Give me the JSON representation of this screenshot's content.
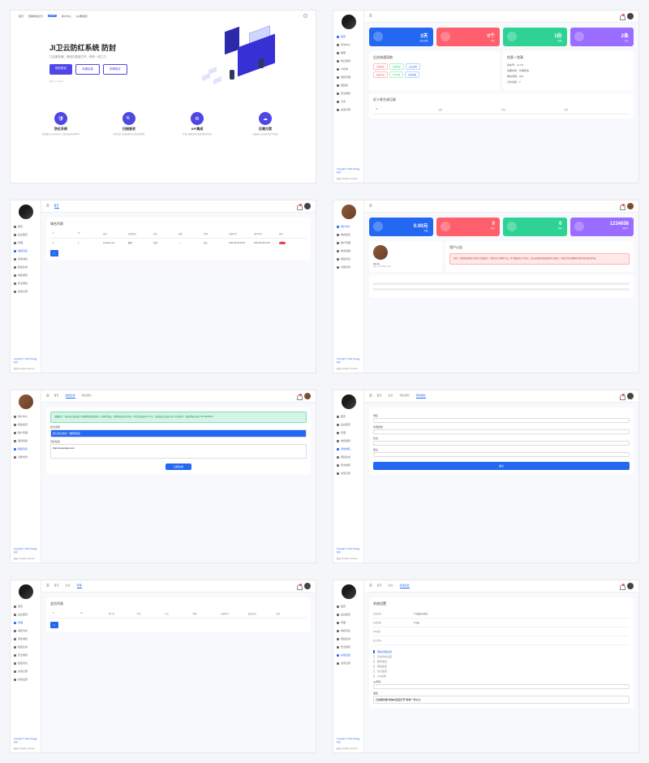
{
  "landing": {
    "nav": [
      "首页",
      "查看我的红分",
      "用户中心",
      "QQ群答题"
    ],
    "nav_badge": "v2.0.8",
    "title": "JI卫云防红系统 防封",
    "subtitle": "已启服务器，微信内直接打开，助你一臂之力",
    "btn_primary": "现在购买",
    "btn_outline1": "详细信息",
    "btn_outline2": "来聊防红",
    "features": [
      {
        "icon": "🛡",
        "title": "防红系统",
        "desc": "长期研发 全自动对抗 专业红队成功率99%"
      },
      {
        "icon": "🔍",
        "title": "扫描查收",
        "desc": "实时监控 多维度检测 自动识别风险"
      },
      {
        "icon": "⚙",
        "title": "API集成",
        "desc": "全接口参数说明 集成到您的系统"
      },
      {
        "icon": "☁",
        "title": "后端方案",
        "desc": "海量云节点加速 稳定不掉线"
      }
    ]
  },
  "dash1": {
    "sidebar": [
      "首页",
      "安全中心",
      "数据",
      "防红规则",
      "IP名单",
      "域名管理",
      "短链接",
      "安全规则",
      "日志",
      "充值记录"
    ],
    "stats": [
      {
        "v": "3天",
        "l": "剩余天数",
        "c": "#2468f2"
      },
      {
        "v": "0个",
        "l": "域名",
        "c": "#ff5e6c"
      },
      {
        "v": "1份",
        "l": "套餐",
        "c": "#2ed295"
      },
      {
        "v": "2条",
        "l": "日志",
        "c": "#9a6cff"
      }
    ],
    "panel_l_title": "后台快速导航",
    "quick": [
      [
        "添加域名",
        "查看列表",
        "安全设置"
      ],
      [
        "短链生成",
        "API文档",
        "充值续费"
      ]
    ],
    "panel_r_title": "信息一览表",
    "info": [
      "版本号：v2.0.8",
      "到期时间：长期有效",
      "剩余调用：999",
      "日志条数：2"
    ],
    "log_title": "近十条生成记录",
    "log_head": [
      "ID",
      "域名",
      "时间",
      "状态"
    ]
  },
  "dash2": {
    "sidebar": [
      "首页",
      "后台首页",
      "管理",
      "域名列表",
      "添加域名",
      "短链生成",
      "域名规则",
      "安全规则",
      "充值记录"
    ],
    "tabs": [
      "首页"
    ],
    "panel_title": "域名列表",
    "thead": [
      "#",
      "ID",
      "域名",
      "处理类型",
      "状态",
      "刷新",
      "到期",
      "创建时间",
      "操作时间",
      "操作"
    ],
    "row": [
      "1",
      "1",
      "example.com",
      "跳转",
      "正常",
      "—",
      "永久",
      "2022-09-09 00:00",
      "2022-09-09 00:00"
    ],
    "row_action": "删除",
    "page": "1"
  },
  "dash3": {
    "sidebar": [
      "用户中心",
      "我的会员",
      "账户管理",
      "邀请奖励",
      "短链列表",
      "对账支持"
    ],
    "stats": [
      {
        "v": "0.00元",
        "l": "余额",
        "c": "#2468f2"
      },
      {
        "v": "0",
        "l": "积分",
        "c": "#ff5e6c"
      },
      {
        "v": "0",
        "l": "优惠",
        "c": "#2ed295"
      },
      {
        "v": "1234658",
        "l": "推荐人",
        "c": "#9a6cff"
      }
    ],
    "prof_name": "admin",
    "prof_uid": "UID: 20220913-000",
    "panel_r_title": "用户公告",
    "alert": "您好，欢迎您使用防红系统产品及服务！请您务必了解本产品，并仔细阅读以下协议；您点击同意并开始使用产品服务，即表示您已理解并同意本协议各项内容。"
  },
  "dash4": {
    "sidebar": [
      "用户中心",
      "我的会员",
      "账户管理",
      "邀请奖励",
      "短链列表",
      "对账支持"
    ],
    "tabs": [
      "首页",
      "短链生成",
      "域名规则"
    ],
    "alert": "温馨提示：请务必认真阅读以下配置项说明后填写！如填写错误，可能将无法正常访问；单次生成支持1-5个url，生成成功后会显示在下方列表中，请及时保存记录 UID:20220913",
    "lbl_mode": "模式选择",
    "sel_val": "默认防红模式（推荐首选）",
    "lbl_url": "目标链接",
    "url_val": "https://example.com",
    "btn_submit": "立即生成"
  },
  "dash5": {
    "sidebar": [
      "首页",
      "后台首页",
      "管理",
      "域名规则",
      "添加域名",
      "短链生成",
      "安全规则",
      "充值记录"
    ],
    "tabs": [
      "首页",
      "后台",
      "域名规则",
      "添加域名"
    ],
    "lbl1": "域名",
    "lbl2": "处理类型",
    "lbl3": "状态",
    "lbl4": "备注",
    "btn_full": "提交"
  },
  "dash6": {
    "sidebar": [
      "首页",
      "后台首页",
      "管理",
      "域名列表",
      "添加域名",
      "短链生成",
      "安全规则",
      "短链列表",
      "充值记录",
      "系统设置"
    ],
    "tabs": [
      "首页",
      "后台",
      "管理"
    ],
    "panel_title": "会员列表",
    "thead": [
      "#",
      "ID",
      "用户名",
      "手机",
      "产品",
      "到期",
      "注册时间",
      "最后登录",
      "操作"
    ],
    "page": "1"
  },
  "dash7": {
    "sidebar": [
      "首页",
      "后台首页",
      "管理",
      "域名列表",
      "短链生成",
      "安全规则",
      "系统设置",
      "充值记录"
    ],
    "tabs": [
      "首页",
      "后台",
      "系统设置"
    ],
    "panel_title": "系统设置",
    "rows": [
      [
        "系统名称",
        "JI卫云防红系统"
      ],
      [
        "系统简称",
        "JI卫云"
      ],
      [
        "ICP备案",
        ""
      ],
      [
        "统计代码",
        ""
      ]
    ],
    "acc": [
      "网站基础设置",
      "安全防护设置",
      "邮件配置",
      "短信配置",
      "支付配置",
      "API设置"
    ],
    "lbl_qq": "qq号码",
    "lbl_desc": "描述",
    "desc_val": "已启服务器 微信内直接打开 助你一臂之力"
  },
  "footer": "Copyright © 2022 JIwei云防控",
  "footer2": "版权 All rights reserved"
}
